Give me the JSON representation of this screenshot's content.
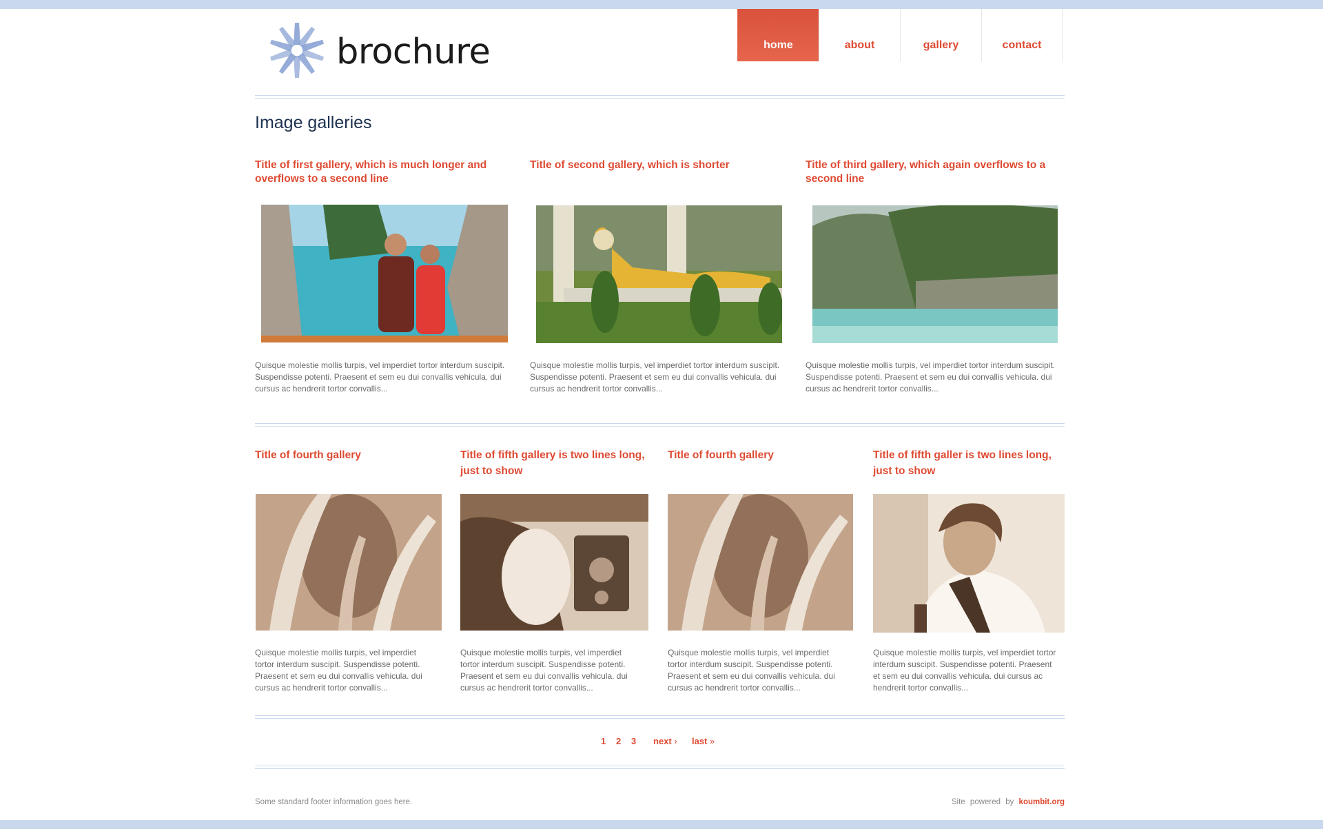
{
  "logo": {
    "text": "brochure"
  },
  "nav": [
    {
      "label": "home",
      "active": true
    },
    {
      "label": "about"
    },
    {
      "label": "gallery"
    },
    {
      "label": "contact"
    }
  ],
  "page_title": "Image galleries",
  "galleries_row1": [
    {
      "title": "Title of first gallery, which is much longer and overflows to a second line",
      "description": "Quisque molestie mollis turpis, vel imperdiet tortor interdum suscipit. Suspendisse potenti. Praesent et sem eu dui convallis vehicula. dui cursus ac hendrerit tortor convallis...",
      "image": "couple-at-lagoon-photo"
    },
    {
      "title": "Title of second gallery, which is shorter",
      "description": "Quisque molestie mollis turpis, vel imperdiet tortor interdum suscipit. Suspendisse potenti. Praesent et sem eu dui convallis vehicula. dui cursus ac hendrerit tortor convallis...",
      "image": "reclining-buddha-photo"
    },
    {
      "title": "Title of third gallery, which again overflows to a second line",
      "description": "Quisque molestie mollis turpis, vel imperdiet tortor interdum suscipit. Suspendisse potenti. Praesent et sem eu dui convallis vehicula. dui cursus ac hendrerit tortor convallis...",
      "image": "limestone-cliffs-bay-photo"
    }
  ],
  "galleries_row2": [
    {
      "title": "Title of fourth gallery",
      "description": "Quisque molestie mollis turpis, vel imperdiet tortor interdum suscipit. Suspendisse potenti. Praesent et sem eu dui convallis vehicula. dui cursus ac hendrerit tortor convallis...",
      "image": "sepia-abstract-leaves-photo"
    },
    {
      "title": "Title of fifth gallery is two lines long, just to show",
      "description": "Quisque molestie mollis turpis, vel imperdiet tortor interdum suscipit. Suspendisse potenti. Praesent et sem eu dui convallis vehicula. dui cursus ac hendrerit tortor convallis...",
      "image": "sepia-camera-operator-photo"
    },
    {
      "title": "Title of fourth gallery",
      "description": "Quisque molestie mollis turpis, vel imperdiet tortor interdum suscipit. Suspendisse potenti. Praesent et sem eu dui convallis vehicula. dui cursus ac hendrerit tortor convallis...",
      "image": "sepia-abstract-leaves-photo"
    },
    {
      "title": "Title of fifth galler is two lines long, just to show",
      "description": "Quisque molestie mollis turpis, vel imperdiet tortor interdum suscipit. Suspendisse potenti. Praesent et sem eu dui convallis vehicula. dui cursus ac hendrerit tortor convallis...",
      "image": "sepia-portrait-man-photo"
    }
  ],
  "pager": {
    "pages": [
      "1",
      "2",
      "3"
    ],
    "next": "next",
    "next_symbol": "›",
    "last": "last",
    "last_symbol": "»"
  },
  "footer": {
    "left": "Some standard footer information goes here.",
    "powered_prefix": "Site powered by",
    "powered_link": "koumbit.org"
  },
  "colors": {
    "accent": "#de4a32",
    "heading": "#1d3150",
    "rule": "#c9d8ec",
    "logo_icon": "#8fa6d6"
  }
}
